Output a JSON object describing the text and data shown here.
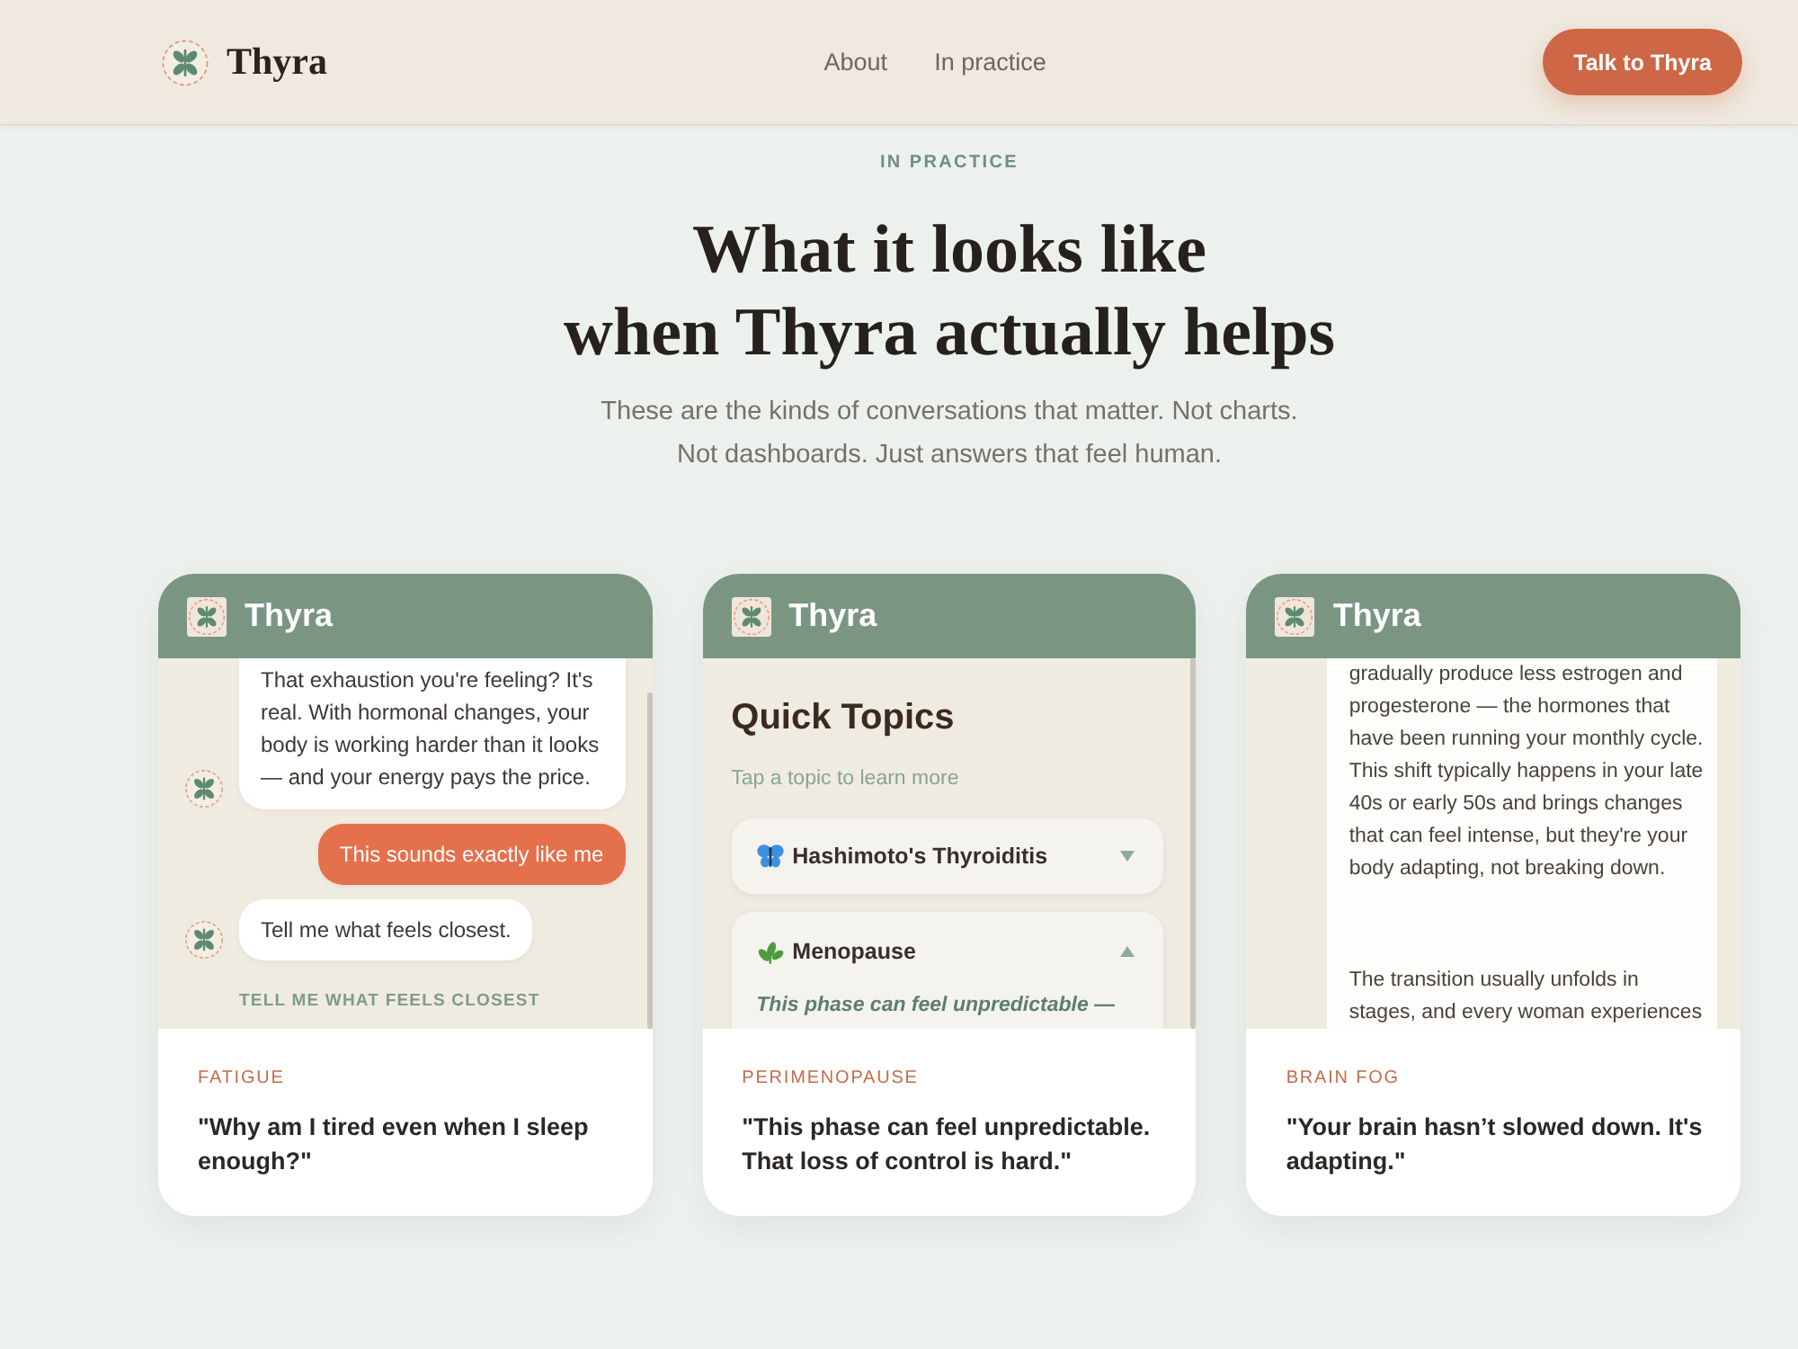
{
  "nav": {
    "brand": "Thyra",
    "links": [
      {
        "label": "About"
      },
      {
        "label": "In practice"
      }
    ],
    "cta": "Talk to Thyra"
  },
  "hero": {
    "eyebrow": "IN PRACTICE",
    "title_lines": [
      "What it looks like",
      "when Thyra actually helps"
    ],
    "subtitle_lines": [
      "These are the kinds of conversations that matter. Not charts.",
      "Not dashboards. Just answers that feel human."
    ]
  },
  "cards": [
    {
      "kind": "chat",
      "title": "Thyra",
      "messages": [
        {
          "kind": "bot",
          "text": "That exhaustion you're feeling? It's real. With hormonal changes, your body is working harder than it looks — and your energy pays the price."
        },
        {
          "kind": "user",
          "text": "This sounds exactly like me"
        },
        {
          "kind": "bot",
          "text": "Tell me what feels closest."
        }
      ],
      "prompt": "TELL ME WHAT FEELS CLOSEST",
      "tag": "FATIGUE",
      "quote": "\"Why am I tired even when I sleep enough?\""
    },
    {
      "kind": "topics",
      "title": "Thyra",
      "heading": "Quick Topics",
      "hint": "Tap a topic to learn more",
      "topics": [
        {
          "label": "Hashimoto's Thyroiditis",
          "expanded": false
        },
        {
          "label": "Menopause",
          "expanded": true,
          "description": "This phase can feel unpredictable —"
        }
      ],
      "tag": "PERIMENOPAUSE",
      "quote": "\"This phase can feel unpredictable. That loss of control is hard.\""
    },
    {
      "kind": "article",
      "title": "Thyra",
      "paragraphs": [
        "gradually produce less estrogen and progesterone — the hormones that have been running your monthly cycle. This shift typically happens in your late 40s or early 50s and brings changes that can feel intense, but they're your body adapting, not breaking down.",
        "The transition usually unfolds in stages, and every woman experiences"
      ],
      "tag": "BRAIN FOG",
      "quote": "\"Your brain hasn’t slowed down. It's adapting.\""
    }
  ]
}
